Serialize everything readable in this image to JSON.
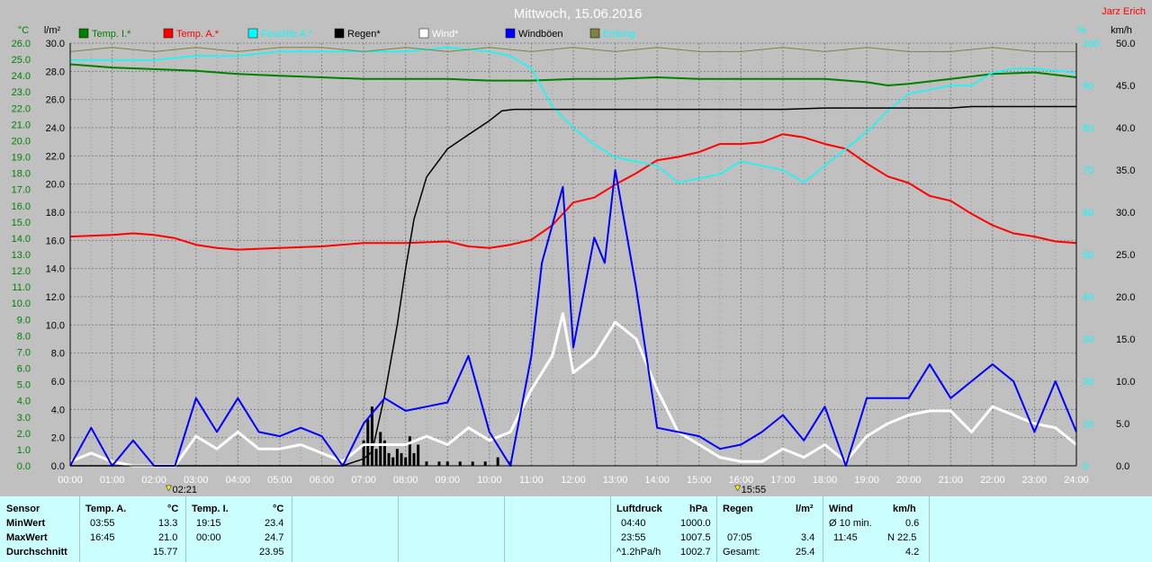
{
  "title": "Mittwoch, 15.06.2016",
  "author": "Jarz Erich",
  "left_units": {
    "celsius": "°C",
    "rain": "l/m²"
  },
  "right_units": {
    "humidity": "%",
    "wind": "km/h"
  },
  "legend": [
    {
      "label": "Temp. I.*",
      "color": "#008000",
      "text_color": "#008000"
    },
    {
      "label": "Temp. A.*",
      "color": "#ff0000",
      "text_color": "#ff0000"
    },
    {
      "label": "Feuchte A.*",
      "color": "#00ffff",
      "text_color": "#00ffff"
    },
    {
      "label": "Regen*",
      "color": "#000000",
      "text_color": "#000000"
    },
    {
      "label": "Wind*",
      "color": "#ffffff",
      "text_color": "#ffffff"
    },
    {
      "label": "Windböen",
      "color": "#0000ff",
      "text_color": "#000000"
    },
    {
      "label": "Erdung",
      "color": "#808040",
      "text_color": "#00ffff"
    }
  ],
  "colors": {
    "background": "#c0c0c0",
    "grid": "#808080",
    "stats_background": "#ccffff"
  },
  "markers": [
    {
      "label": "02:21",
      "hour": 2.35
    },
    {
      "label": "15:55",
      "hour": 15.92
    }
  ],
  "chart_data": {
    "type": "line",
    "title": "Mittwoch, 15.06.2016",
    "x_range": [
      0,
      24
    ],
    "x_ticks": [
      "00:00",
      "01:00",
      "02:00",
      "03:00",
      "04:00",
      "05:00",
      "06:00",
      "07:00",
      "08:00",
      "09:00",
      "10:00",
      "11:00",
      "12:00",
      "13:00",
      "14:00",
      "15:00",
      "16:00",
      "17:00",
      "18:00",
      "19:00",
      "20:00",
      "21:00",
      "22:00",
      "23:00",
      "24:00"
    ],
    "axes": {
      "temp_c": {
        "range": [
          0,
          26
        ],
        "ticks": [
          "0.0",
          "1.0",
          "2.0",
          "3.0",
          "4.0",
          "5.0",
          "6.0",
          "7.0",
          "8.0",
          "9.0",
          "10.0",
          "11.0",
          "12.0",
          "13.0",
          "14.0",
          "15.0",
          "16.0",
          "17.0",
          "18.0",
          "19.0",
          "20.0",
          "21.0",
          "22.0",
          "23.0",
          "24.0",
          "25.0",
          "26.0"
        ]
      },
      "rain_lm2": {
        "range": [
          0,
          30
        ],
        "ticks": [
          "0.0",
          "2.0",
          "4.0",
          "6.0",
          "8.0",
          "10.0",
          "12.0",
          "14.0",
          "16.0",
          "18.0",
          "20.0",
          "22.0",
          "24.0",
          "26.0",
          "28.0",
          "30.0"
        ]
      },
      "humidity_pct": {
        "range": [
          0,
          100
        ],
        "ticks": [
          "0",
          "10",
          "20",
          "30",
          "40",
          "50",
          "60",
          "70",
          "80",
          "90",
          "100"
        ]
      },
      "wind_kmh": {
        "range": [
          0,
          50
        ],
        "ticks": [
          "0.0",
          "5.0",
          "10.0",
          "15.0",
          "20.0",
          "25.0",
          "30.0",
          "35.0",
          "40.0",
          "45.0",
          "50.0"
        ]
      }
    },
    "series": [
      {
        "name": "Temp. I.*",
        "axis": "temp_c",
        "color": "#008000",
        "x": [
          0,
          1,
          2,
          3,
          4,
          5,
          6,
          7,
          8,
          9,
          10,
          11,
          12,
          13,
          14,
          15,
          16,
          17,
          18,
          19,
          19.5,
          20,
          21,
          22,
          23,
          24
        ],
        "y": [
          24.7,
          24.5,
          24.4,
          24.3,
          24.1,
          24.0,
          23.9,
          23.8,
          23.8,
          23.8,
          23.7,
          23.7,
          23.8,
          23.8,
          23.9,
          23.8,
          23.8,
          23.8,
          23.8,
          23.6,
          23.4,
          23.5,
          23.8,
          24.1,
          24.2,
          23.9
        ]
      },
      {
        "name": "Temp. A.*",
        "axis": "temp_c",
        "color": "#ff0000",
        "x": [
          0,
          1,
          1.5,
          2,
          2.5,
          3,
          3.5,
          4,
          5,
          6,
          7,
          8,
          9,
          9.5,
          10,
          10.5,
          11,
          11.5,
          12,
          12.5,
          13,
          13.5,
          14,
          14.5,
          15,
          15.5,
          16,
          16.5,
          17,
          17.5,
          18,
          18.5,
          19,
          19.5,
          20,
          20.5,
          21,
          21.5,
          22,
          22.5,
          23,
          23.5,
          24
        ],
        "y": [
          14.1,
          14.2,
          14.3,
          14.2,
          14.0,
          13.6,
          13.4,
          13.3,
          13.4,
          13.5,
          13.7,
          13.7,
          13.8,
          13.5,
          13.4,
          13.6,
          13.9,
          14.8,
          16.2,
          16.5,
          17.3,
          18.0,
          18.8,
          19.0,
          19.3,
          19.8,
          19.8,
          19.9,
          20.4,
          20.2,
          19.8,
          19.5,
          18.6,
          17.8,
          17.4,
          16.6,
          16.3,
          15.5,
          14.8,
          14.3,
          14.1,
          13.8,
          13.7
        ]
      },
      {
        "name": "Feuchte A.*",
        "axis": "humidity_pct",
        "color": "#00ffff",
        "x": [
          0,
          1,
          2,
          3,
          4,
          5,
          6,
          7,
          8,
          9,
          10,
          10.5,
          11,
          11.5,
          12,
          12.5,
          13,
          13.5,
          14,
          14.5,
          15,
          15.5,
          16,
          16.5,
          17,
          17.5,
          18,
          18.5,
          19,
          19.5,
          20,
          20.5,
          21,
          21.5,
          22,
          22.5,
          23,
          24
        ],
        "y": [
          96,
          96,
          96,
          97,
          97,
          98,
          98,
          98,
          98,
          99,
          98,
          97,
          94,
          85,
          80,
          76,
          73,
          72,
          71,
          67,
          68,
          69,
          72,
          71,
          70,
          67,
          71,
          75,
          79,
          84,
          88,
          89,
          90,
          90,
          93,
          94,
          94,
          93
        ]
      },
      {
        "name": "Regen*",
        "axis": "rain_lm2",
        "color": "#000000",
        "x": [
          0,
          6.5,
          7,
          7.2,
          7.5,
          7.8,
          8,
          8.2,
          8.5,
          9,
          9.5,
          10,
          10.3,
          10.6,
          11,
          12,
          13,
          14,
          15,
          15.92,
          16,
          17,
          18,
          19,
          20,
          21,
          21.5,
          22,
          23,
          24
        ],
        "y": [
          0,
          0,
          0.5,
          1.0,
          5.0,
          10.0,
          14.0,
          17.5,
          20.5,
          22.5,
          23.5,
          24.5,
          25.2,
          25.3,
          25.3,
          25.3,
          25.3,
          25.3,
          25.3,
          25.3,
          25.3,
          25.3,
          25.4,
          25.4,
          25.4,
          25.4,
          25.5,
          25.5,
          25.5,
          25.5
        ]
      },
      {
        "name": "Wind*",
        "axis": "wind_kmh",
        "color": "#ffffff",
        "x": [
          0,
          0.5,
          1,
          1.5,
          2,
          2.5,
          3,
          3.5,
          4,
          4.5,
          5,
          5.5,
          6,
          6.5,
          7,
          7.5,
          8,
          8.5,
          9,
          9.5,
          10,
          10.5,
          11,
          11.5,
          11.75,
          12,
          12.5,
          13,
          13.5,
          14,
          14.5,
          15,
          15.5,
          16,
          16.5,
          17,
          17.5,
          18,
          18.5,
          19,
          19.5,
          20,
          20.5,
          21,
          21.5,
          22,
          22.5,
          23,
          23.5,
          24
        ],
        "y": [
          0.5,
          1.5,
          0.5,
          0,
          0,
          0,
          3.5,
          2.0,
          4.0,
          2.0,
          2.0,
          2.5,
          1.5,
          0.5,
          2.5,
          2.5,
          2.5,
          3.5,
          2.5,
          4.5,
          3.0,
          4.0,
          9.0,
          13.0,
          18.0,
          11.0,
          13.0,
          17.0,
          15.0,
          9.0,
          4.0,
          2.5,
          1.0,
          0.5,
          0.5,
          2.0,
          1.0,
          2.5,
          0.5,
          3.5,
          5.0,
          6.0,
          6.5,
          6.5,
          4.0,
          7.0,
          6.0,
          5.0,
          4.5,
          2.5
        ]
      },
      {
        "name": "Windböen",
        "axis": "wind_kmh",
        "color": "#0000ff",
        "x": [
          0,
          0.5,
          1,
          1.5,
          2,
          2.5,
          3,
          3.5,
          4,
          4.5,
          5,
          5.5,
          6,
          6.5,
          7,
          7.5,
          8,
          8.5,
          9,
          9.5,
          10,
          10.5,
          11,
          11.25,
          11.75,
          12,
          12.5,
          12.75,
          13,
          13.5,
          14,
          14.5,
          15,
          15.5,
          16,
          16.5,
          17,
          17.5,
          18,
          18.5,
          19,
          19.5,
          20,
          20.5,
          21,
          21.5,
          22,
          22.5,
          23,
          23.5,
          24
        ],
        "y": [
          0,
          4.5,
          0,
          3.0,
          0,
          0,
          8.0,
          4.0,
          8.0,
          4.0,
          3.5,
          4.5,
          3.5,
          0,
          5.0,
          8.0,
          6.5,
          7.0,
          7.5,
          13.0,
          4.0,
          0,
          13.0,
          24.0,
          33.0,
          14.0,
          27.0,
          24.0,
          35.0,
          21.0,
          4.5,
          4.0,
          3.5,
          2.0,
          2.5,
          4.0,
          6.0,
          3.0,
          7.0,
          0,
          8.0,
          8.0,
          8.0,
          12.0,
          8.0,
          10.0,
          12.0,
          10.0,
          4.0,
          10.0,
          4.0
        ]
      },
      {
        "name": "Erdung",
        "axis": "humidity_pct",
        "color": "#808040",
        "x": [
          0,
          1,
          2,
          3,
          4,
          5,
          6,
          7,
          8,
          9,
          10,
          11,
          12,
          13,
          14,
          15,
          16,
          17,
          18,
          19,
          20,
          21,
          22,
          23,
          24
        ],
        "y": [
          98,
          99,
          98,
          99,
          98,
          99,
          99,
          98,
          99,
          98,
          99,
          98,
          99,
          98,
          99,
          98,
          98,
          99,
          98,
          99,
          98,
          98,
          99,
          98,
          98
        ]
      }
    ],
    "rain_bars": {
      "axis": "wind_kmh",
      "x": [
        7.0,
        7.1,
        7.2,
        7.3,
        7.4,
        7.5,
        7.6,
        7.7,
        7.8,
        7.9,
        8.0,
        8.1,
        8.2,
        8.3,
        8.5,
        8.8,
        9.0,
        9.3,
        9.6,
        9.9,
        10.2,
        10.5
      ],
      "y": [
        3.0,
        5.5,
        7.0,
        2.0,
        4.0,
        3.0,
        1.5,
        1.0,
        2.0,
        1.5,
        1.0,
        3.5,
        1.5,
        2.5,
        0.5,
        0.5,
        0.5,
        0.5,
        0.5,
        0.5,
        1.0,
        0.5
      ]
    },
    "grid": true
  },
  "stats": {
    "sensor": {
      "header": "Sensor",
      "rows": [
        "MinWert",
        "MaxWert",
        "Durchschnitt"
      ]
    },
    "temp_a": {
      "header": "Temp. A.",
      "unit": "°C",
      "min_time": "03:55",
      "min": "13.3",
      "max_time": "16:45",
      "max": "21.0",
      "avg": "15.77"
    },
    "temp_i": {
      "header": "Temp. I.",
      "unit": "°C",
      "min_time": "19:15",
      "min": "23.4",
      "max_time": "00:00",
      "max": "24.7",
      "avg": "23.95"
    },
    "pressure": {
      "header": "Luftdruck",
      "unit": "hPa",
      "min_time": "04:40",
      "min": "1000.0",
      "max_time": "23:55",
      "max": "1007.5",
      "trend": "^1.2hPa/h",
      "avg": "1002.7"
    },
    "rain": {
      "header": "Regen",
      "unit": "l/m²",
      "max_time": "07:05",
      "max": "3.4",
      "total_label": "Gesamt:",
      "total": "25.4"
    },
    "wind": {
      "header": "Wind",
      "unit": "km/h",
      "avg10_label": "Ø 10 min.",
      "avg10": "0.6",
      "max_time": "11:45",
      "max": "N 22.5",
      "avg": "4.2"
    }
  }
}
